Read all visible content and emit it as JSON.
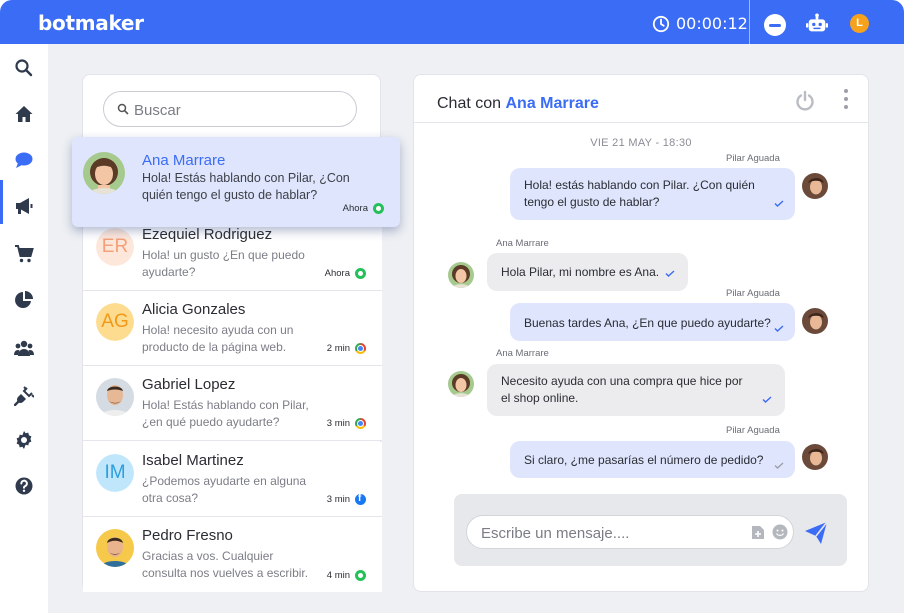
{
  "app": {
    "logo": "botmaker",
    "timer": "00:00:12",
    "user_initial": "L",
    "accent": "#3b6cf6"
  },
  "sidebar": {
    "items": [
      {
        "icon": "search-icon"
      },
      {
        "icon": "home-icon"
      },
      {
        "icon": "chat-icon",
        "active": true
      },
      {
        "icon": "megaphone-icon"
      },
      {
        "icon": "cart-icon"
      },
      {
        "icon": "pie-chart-icon"
      },
      {
        "icon": "users-icon"
      },
      {
        "icon": "plug-icon"
      },
      {
        "icon": "gear-icon"
      },
      {
        "icon": "help-icon"
      }
    ]
  },
  "search": {
    "placeholder": "Buscar"
  },
  "conversations": [
    {
      "name": "Ana Marrare",
      "preview": "Hola! Estás hablando con Pilar, ¿Con quién tengo el gusto de hablar?",
      "time": "Ahora",
      "channel": "whatsapp",
      "avatar": "photo",
      "active": true
    },
    {
      "name": "Ezequiel Rodriguez",
      "preview": "Hola! un gusto ¿En que puedo ayudarte?",
      "time": "Ahora",
      "channel": "whatsapp",
      "avatar": "ER",
      "avatar_bg": "#fde7da",
      "avatar_fg": "#f4a07a"
    },
    {
      "name": "Alicia Gonzales",
      "preview": "Hola! necesito ayuda con un producto de la página web.",
      "time": "2 min",
      "channel": "web",
      "avatar": "AG",
      "avatar_bg": "#fddb8f",
      "avatar_fg": "#f09a1a"
    },
    {
      "name": "Gabriel Lopez",
      "preview": "Hola! Estás hablando con Pilar, ¿en qué puedo ayudarte?",
      "time": "3 min",
      "channel": "web",
      "avatar": "photo"
    },
    {
      "name": "Isabel Martinez",
      "preview": "¿Podemos ayudarte en alguna otra cosa?",
      "time": "3 min",
      "channel": "facebook",
      "avatar": "IM",
      "avatar_bg": "#bfe6fb",
      "avatar_fg": "#2e9fdc"
    },
    {
      "name": "Pedro Fresno",
      "preview": "Gracias a vos. Cualquier consulta nos vuelves a escribir.",
      "time": "4 min",
      "channel": "whatsapp",
      "avatar": "photo"
    }
  ],
  "chat": {
    "title_prefix": "Chat con",
    "contact": "Ana Marrare",
    "date": "VIE 21 MAY  - 18:30",
    "messages": [
      {
        "sender": "Pilar Aguada",
        "direction": "out",
        "lines": [
          "Hola! estás hablando con Pilar.  ¿Con quién",
          "tengo el gusto de hablar?"
        ]
      },
      {
        "sender": "Ana Marrare",
        "direction": "in",
        "lines": [
          "Hola Pilar, mi nombre es Ana."
        ]
      },
      {
        "sender": "Pilar Aguada",
        "direction": "out",
        "lines": [
          "Buenas tardes Ana, ¿En que puedo ayudarte?"
        ]
      },
      {
        "sender": "Ana Marrare",
        "direction": "in",
        "lines": [
          "Necesito ayuda con una compra que hice por",
          "el shop online."
        ]
      },
      {
        "sender": "Pilar Aguada",
        "direction": "out",
        "lines": [
          "Si claro, ¿me pasarías el número de pedido?"
        ]
      }
    ],
    "composer_placeholder": "Escribe un mensaje...."
  }
}
